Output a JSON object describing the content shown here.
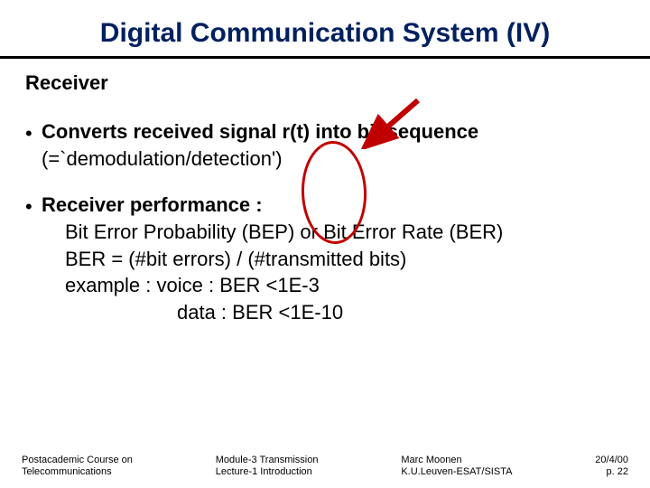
{
  "title": "Digital Communication System (IV)",
  "section": "Receiver",
  "bullets": [
    {
      "lead": "Converts received signal  r(t) into bit sequence",
      "sub": "(=`demodulation/detection')"
    },
    {
      "lead": "Receiver performance :",
      "lines": [
        "Bit Error Probability (BEP) or Bit Error Rate (BER)",
        "BER = (#bit errors) / (#transmitted bits)",
        "example :   voice : BER <1E-3"
      ],
      "line_align": "data  : BER <1E-10"
    }
  ],
  "footer": {
    "left": {
      "l1": "Postacademic Course on",
      "l2": "Telecommunications"
    },
    "mid1": {
      "l1": "Module-3  Transmission",
      "l2": "Lecture-1  Introduction"
    },
    "mid2": {
      "l1": "Marc Moonen",
      "l2": "K.U.Leuven-ESAT/SISTA"
    },
    "right": {
      "l1": "20/4/00",
      "l2": "p. 22"
    }
  }
}
